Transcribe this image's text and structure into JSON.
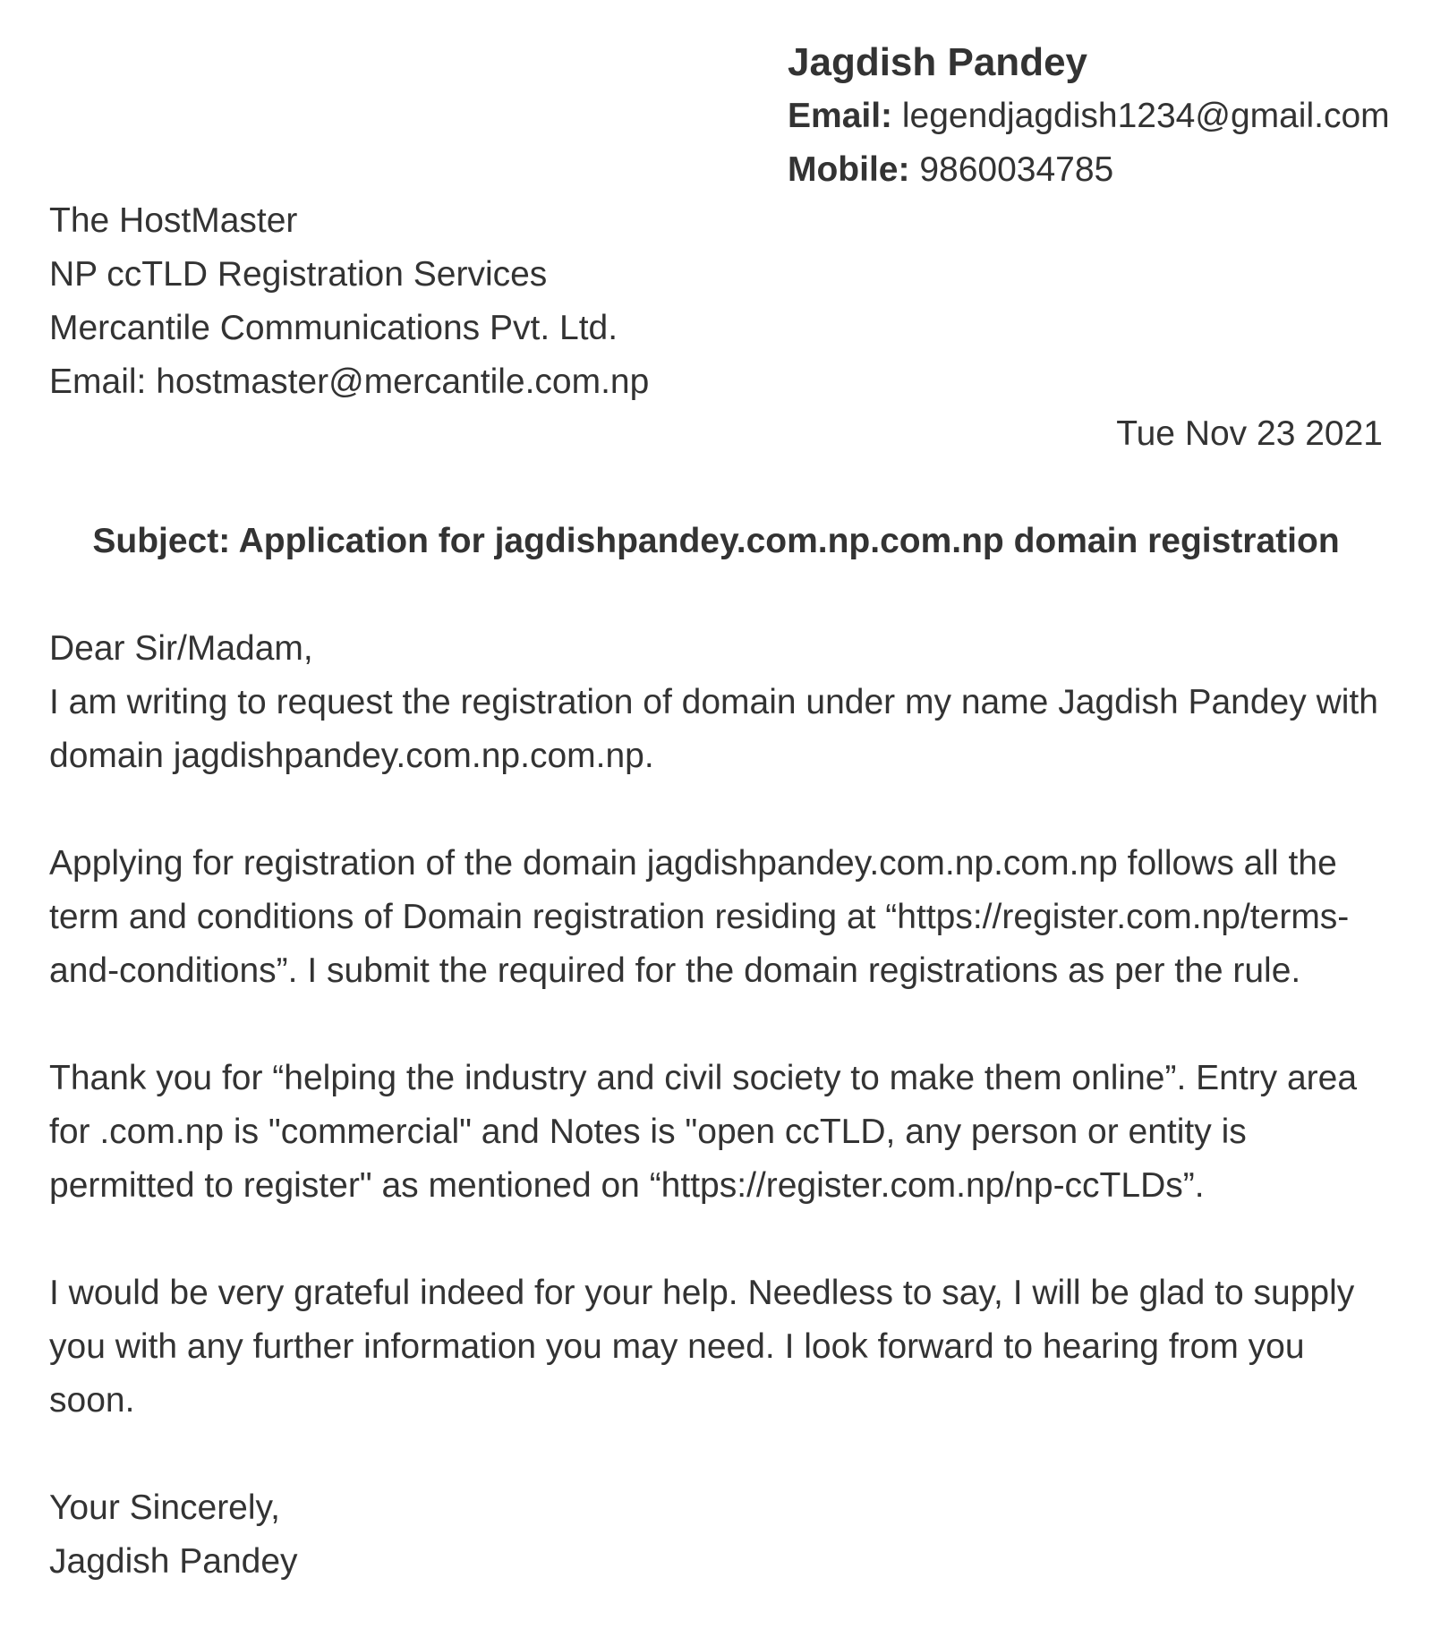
{
  "sender": {
    "name": "Jagdish Pandey",
    "email_label": "Email:",
    "email": "legendjagdish1234@gmail.com",
    "mobile_label": "Mobile:",
    "mobile": "9860034785"
  },
  "recipient": {
    "line1": "The HostMaster",
    "line2": "NP ccTLD Registration Services",
    "line3": "Mercantile Communications Pvt. Ltd.",
    "line4": "Email: hostmaster@mercantile.com.np"
  },
  "date": "Tue Nov 23 2021",
  "subject": "Subject: Application for jagdishpandey.com.np.com.np domain registration",
  "body": {
    "greeting": "Dear Sir/Madam,",
    "p1": "I am writing to request the registration of domain under my name Jagdish Pandey with domain jagdishpandey.com.np.com.np.",
    "p2": "Applying for registration of the domain jagdishpandey.com.np.com.np follows all the term and conditions of Domain registration residing at “https://register.com.np/terms-and-conditions”. I submit the required for the domain registrations as per the rule.",
    "p3": "Thank you for “helping the industry and civil society to make them online”. Entry area for .com.np is \"commercial\" and Notes is \"open ccTLD, any person or entity is permitted to register\" as mentioned on “https://register.com.np/np-ccTLDs”.",
    "p4": "I would be very grateful indeed for your help. Needless to say, I will be glad to supply you with any further information you may need. I look forward to hearing from you soon."
  },
  "closing": {
    "line1": "Your Sincerely,",
    "line2": "Jagdish Pandey"
  }
}
